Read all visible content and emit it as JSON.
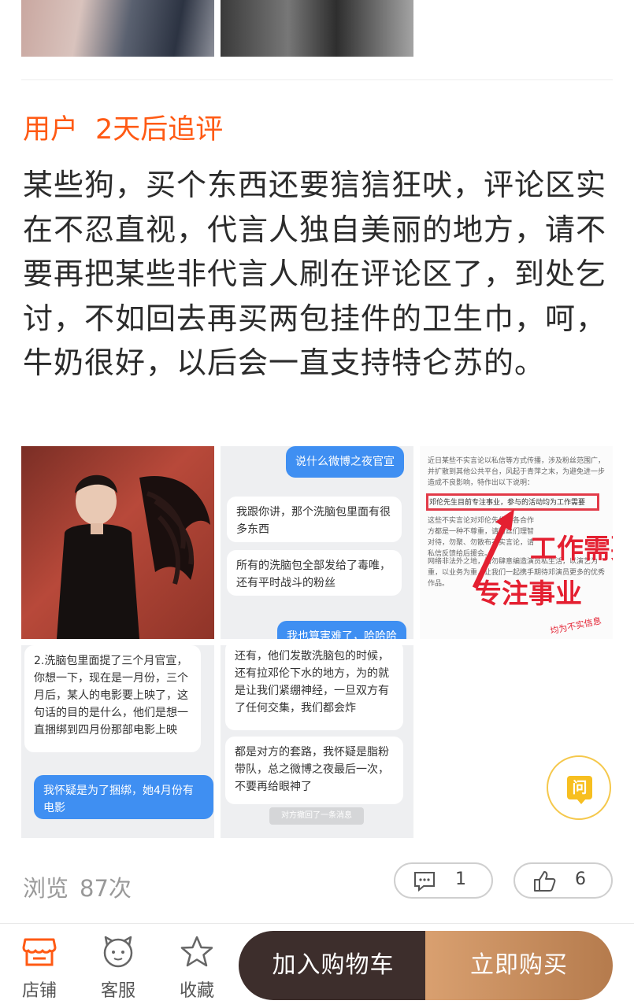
{
  "followup": {
    "user": "用户",
    "when": "2天后追评"
  },
  "review_text": "某些狗，买个东西还要狺狺狂吠，评论区实在不忍直视，代言人独自美丽的地方，请不要再把某些非代言人刷在评论区了，到处乞讨，不如回去再买两包挂件的卫生巾，呵，牛奶很好，以后会一直支持特仑苏的。",
  "images": {
    "chat1": {
      "top_bubble": "说什么微博之夜官宣",
      "bubble1": "我跟你讲，那个洗脑包里面有很多东西",
      "bubble2": "所有的洗脑包全部发给了毒唯，还有平时战斗的粉丝",
      "bottom_bubble": "我也算害难了，哈哈哈"
    },
    "notice": {
      "intro": "近日某些不实言论以私信等方式传播，涉及粉丝范围广，并扩散到其他公共平台，风起于青萍之末，为避免进一步造成不良影响，特作出以下说明：",
      "highlight": "邓伦先生目前专注事业，参与的活动均为工作需要",
      "after": "这些不实言论对邓伦先生及各合作方都是一种不尊重，请粉丝们理智对待，勿聚、勿散布不实言论，请私信反馈给后援会。",
      "para2": "网络非法外之地，请勿肆意编造演员私生活，以演艺为重，以业务为重，让我们一起携手期待邓演员更多的优秀作品。",
      "big1": "工作需要",
      "big2": "专注事业",
      "stamp": "均为不实信息"
    },
    "chat2": {
      "bubble1": "2.洗脑包里面提了三个月官宣，你想一下，现在是一月份，三个月后，某人的电影要上映了，这句话的目的是什么，他们是想一直捆绑到四月份那部电影上映",
      "bubble2": "我怀疑是为了捆绑，她4月份有电影"
    },
    "chat3": {
      "bubble1": "还有，他们发散洗脑包的时候，还有拉邓伦下水的地方，为的就是让我们紧绷神经，一旦双方有了任何交集，我们都会炸",
      "bubble2": "都是对方的套路，我怀疑是脂粉带队，总之微博之夜最后一次，不要再给眼神了",
      "system": "对方撤回了一条消息"
    }
  },
  "ask_button": {
    "label": "问"
  },
  "stats": {
    "views_label": "浏览",
    "views_count": "87次",
    "comment_count": "1",
    "like_count": "6"
  },
  "bottom_nav": {
    "shop": "店铺",
    "service": "客服",
    "favorite": "收藏",
    "add_to_cart": "加入购物车",
    "buy_now": "立即购买"
  },
  "colors": {
    "accent_orange": "#ff5a14",
    "cart_button": "#3d2e2c",
    "buy_button": "#c98d5c",
    "ask_yellow": "#f7bf20"
  }
}
